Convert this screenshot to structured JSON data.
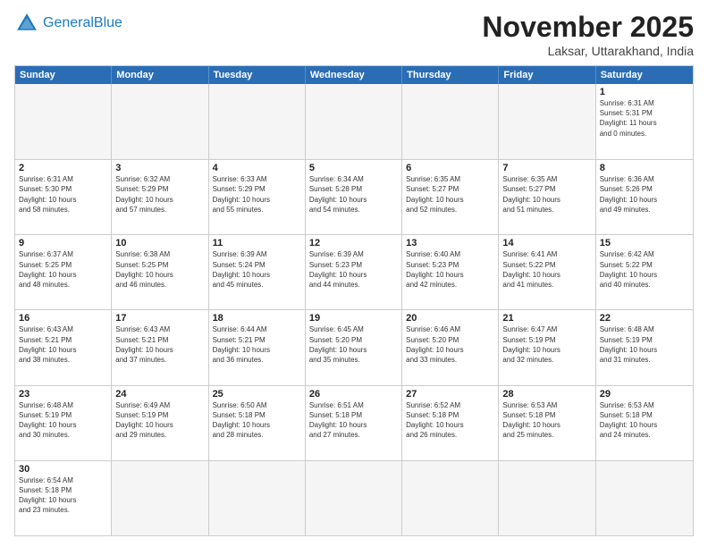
{
  "header": {
    "logo_general": "General",
    "logo_blue": "Blue",
    "month_title": "November 2025",
    "location": "Laksar, Uttarakhand, India"
  },
  "weekdays": [
    "Sunday",
    "Monday",
    "Tuesday",
    "Wednesday",
    "Thursday",
    "Friday",
    "Saturday"
  ],
  "rows": [
    [
      {
        "day": "",
        "info": ""
      },
      {
        "day": "",
        "info": ""
      },
      {
        "day": "",
        "info": ""
      },
      {
        "day": "",
        "info": ""
      },
      {
        "day": "",
        "info": ""
      },
      {
        "day": "",
        "info": ""
      },
      {
        "day": "1",
        "info": "Sunrise: 6:31 AM\nSunset: 5:31 PM\nDaylight: 11 hours\nand 0 minutes."
      }
    ],
    [
      {
        "day": "2",
        "info": "Sunrise: 6:31 AM\nSunset: 5:30 PM\nDaylight: 10 hours\nand 58 minutes."
      },
      {
        "day": "3",
        "info": "Sunrise: 6:32 AM\nSunset: 5:29 PM\nDaylight: 10 hours\nand 57 minutes."
      },
      {
        "day": "4",
        "info": "Sunrise: 6:33 AM\nSunset: 5:29 PM\nDaylight: 10 hours\nand 55 minutes."
      },
      {
        "day": "5",
        "info": "Sunrise: 6:34 AM\nSunset: 5:28 PM\nDaylight: 10 hours\nand 54 minutes."
      },
      {
        "day": "6",
        "info": "Sunrise: 6:35 AM\nSunset: 5:27 PM\nDaylight: 10 hours\nand 52 minutes."
      },
      {
        "day": "7",
        "info": "Sunrise: 6:35 AM\nSunset: 5:27 PM\nDaylight: 10 hours\nand 51 minutes."
      },
      {
        "day": "8",
        "info": "Sunrise: 6:36 AM\nSunset: 5:26 PM\nDaylight: 10 hours\nand 49 minutes."
      }
    ],
    [
      {
        "day": "9",
        "info": "Sunrise: 6:37 AM\nSunset: 5:25 PM\nDaylight: 10 hours\nand 48 minutes."
      },
      {
        "day": "10",
        "info": "Sunrise: 6:38 AM\nSunset: 5:25 PM\nDaylight: 10 hours\nand 46 minutes."
      },
      {
        "day": "11",
        "info": "Sunrise: 6:39 AM\nSunset: 5:24 PM\nDaylight: 10 hours\nand 45 minutes."
      },
      {
        "day": "12",
        "info": "Sunrise: 6:39 AM\nSunset: 5:23 PM\nDaylight: 10 hours\nand 44 minutes."
      },
      {
        "day": "13",
        "info": "Sunrise: 6:40 AM\nSunset: 5:23 PM\nDaylight: 10 hours\nand 42 minutes."
      },
      {
        "day": "14",
        "info": "Sunrise: 6:41 AM\nSunset: 5:22 PM\nDaylight: 10 hours\nand 41 minutes."
      },
      {
        "day": "15",
        "info": "Sunrise: 6:42 AM\nSunset: 5:22 PM\nDaylight: 10 hours\nand 40 minutes."
      }
    ],
    [
      {
        "day": "16",
        "info": "Sunrise: 6:43 AM\nSunset: 5:21 PM\nDaylight: 10 hours\nand 38 minutes."
      },
      {
        "day": "17",
        "info": "Sunrise: 6:43 AM\nSunset: 5:21 PM\nDaylight: 10 hours\nand 37 minutes."
      },
      {
        "day": "18",
        "info": "Sunrise: 6:44 AM\nSunset: 5:21 PM\nDaylight: 10 hours\nand 36 minutes."
      },
      {
        "day": "19",
        "info": "Sunrise: 6:45 AM\nSunset: 5:20 PM\nDaylight: 10 hours\nand 35 minutes."
      },
      {
        "day": "20",
        "info": "Sunrise: 6:46 AM\nSunset: 5:20 PM\nDaylight: 10 hours\nand 33 minutes."
      },
      {
        "day": "21",
        "info": "Sunrise: 6:47 AM\nSunset: 5:19 PM\nDaylight: 10 hours\nand 32 minutes."
      },
      {
        "day": "22",
        "info": "Sunrise: 6:48 AM\nSunset: 5:19 PM\nDaylight: 10 hours\nand 31 minutes."
      }
    ],
    [
      {
        "day": "23",
        "info": "Sunrise: 6:48 AM\nSunset: 5:19 PM\nDaylight: 10 hours\nand 30 minutes."
      },
      {
        "day": "24",
        "info": "Sunrise: 6:49 AM\nSunset: 5:19 PM\nDaylight: 10 hours\nand 29 minutes."
      },
      {
        "day": "25",
        "info": "Sunrise: 6:50 AM\nSunset: 5:18 PM\nDaylight: 10 hours\nand 28 minutes."
      },
      {
        "day": "26",
        "info": "Sunrise: 6:51 AM\nSunset: 5:18 PM\nDaylight: 10 hours\nand 27 minutes."
      },
      {
        "day": "27",
        "info": "Sunrise: 6:52 AM\nSunset: 5:18 PM\nDaylight: 10 hours\nand 26 minutes."
      },
      {
        "day": "28",
        "info": "Sunrise: 6:53 AM\nSunset: 5:18 PM\nDaylight: 10 hours\nand 25 minutes."
      },
      {
        "day": "29",
        "info": "Sunrise: 6:53 AM\nSunset: 5:18 PM\nDaylight: 10 hours\nand 24 minutes."
      }
    ],
    [
      {
        "day": "30",
        "info": "Sunrise: 6:54 AM\nSunset: 5:18 PM\nDaylight: 10 hours\nand 23 minutes."
      },
      {
        "day": "",
        "info": ""
      },
      {
        "day": "",
        "info": ""
      },
      {
        "day": "",
        "info": ""
      },
      {
        "day": "",
        "info": ""
      },
      {
        "day": "",
        "info": ""
      },
      {
        "day": "",
        "info": ""
      }
    ]
  ]
}
